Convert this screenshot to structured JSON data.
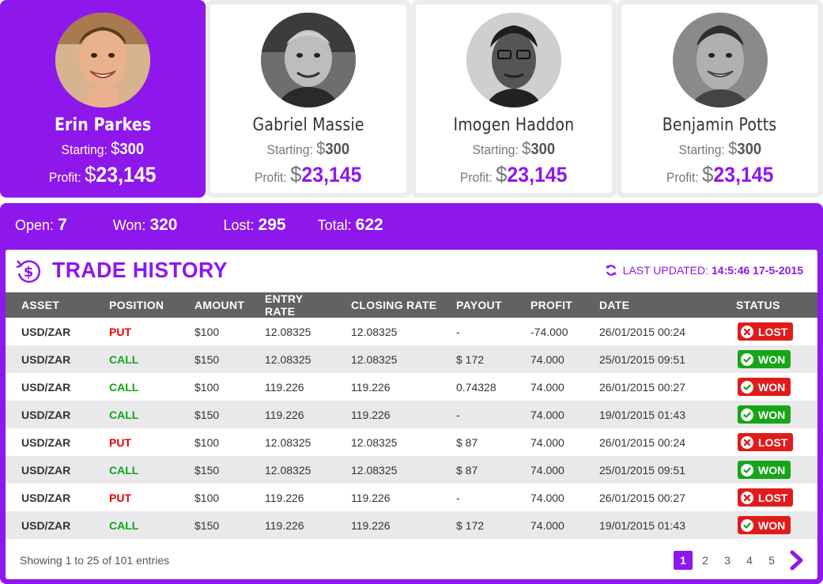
{
  "traders": [
    {
      "name": "Erin Parkes",
      "starting_label": "Starting:",
      "currency": "$",
      "starting_value": "300",
      "profit_label": "Profit:",
      "profit_value": "23,145",
      "active": true
    },
    {
      "name": "Gabriel Massie",
      "starting_label": "Starting:",
      "currency": "$",
      "starting_value": "300",
      "profit_label": "Profit:",
      "profit_value": "23,145",
      "active": false
    },
    {
      "name": "Imogen Haddon",
      "starting_label": "Starting:",
      "currency": "$",
      "starting_value": "300",
      "profit_label": "Profit:",
      "profit_value": "23,145",
      "active": false
    },
    {
      "name": "Benjamin Potts",
      "starting_label": "Starting:",
      "currency": "$",
      "starting_value": "300",
      "profit_label": "Profit:",
      "profit_value": "23,145",
      "active": false
    }
  ],
  "stats": {
    "open_label": "Open:",
    "open_value": "7",
    "won_label": "Won:",
    "won_value": "320",
    "lost_label": "Lost:",
    "lost_value": "295",
    "total_label": "Total:",
    "total_value": "622"
  },
  "history": {
    "title": "TRADE HISTORY",
    "updated_label": "LAST UPDATED:",
    "updated_value": "14:5:46 17-5-2015",
    "columns": [
      "ASSET",
      "POSITION",
      "AMOUNT",
      "ENTRY RATE",
      "CLOSING RATE",
      "PAYOUT",
      "PROFIT",
      "DATE",
      "STATUS"
    ],
    "rows": [
      {
        "asset": "USD/ZAR",
        "position": "PUT",
        "amount": "$100",
        "entry": "12.08325",
        "closing": "12.08325",
        "payout": "-",
        "profit": "-74.000",
        "date": "26/01/2015 00:24",
        "status": "LOST"
      },
      {
        "asset": "USD/ZAR",
        "position": "CALL",
        "amount": "$150",
        "entry": "12.08325",
        "closing": "12.08325",
        "payout": "$ 172",
        "profit": "74.000",
        "date": "25/01/2015 09:51",
        "status": "WON"
      },
      {
        "asset": "USD/ZAR",
        "position": "CALL",
        "amount": "$100",
        "entry": "119.226",
        "closing": "119.226",
        "payout": "0.74328",
        "profit": "74.000",
        "date": "26/01/2015 00:27",
        "status": "WON"
      },
      {
        "asset": "USD/ZAR",
        "position": "CALL",
        "amount": "$150",
        "entry": "119.226",
        "closing": "119.226",
        "payout": "-",
        "profit": "74.000",
        "date": "19/01/2015 01:43",
        "status": "WON"
      },
      {
        "asset": "USD/ZAR",
        "position": "PUT",
        "amount": "$100",
        "entry": "12.08325",
        "closing": "12.08325",
        "payout": "$ 87",
        "profit": "74.000",
        "date": "26/01/2015 00:24",
        "status": "LOST"
      },
      {
        "asset": "USD/ZAR",
        "position": "CALL",
        "amount": "$150",
        "entry": "12.08325",
        "closing": "12.08325",
        "payout": "$ 87",
        "profit": "74.000",
        "date": "25/01/2015 09:51",
        "status": "WON"
      },
      {
        "asset": "USD/ZAR",
        "position": "PUT",
        "amount": "$100",
        "entry": "119.226",
        "closing": "119.226",
        "payout": "-",
        "profit": "74.000",
        "date": "26/01/2015 00:27",
        "status": "LOST"
      },
      {
        "asset": "USD/ZAR",
        "position": "CALL",
        "amount": "$150",
        "entry": "119.226",
        "closing": "119.226",
        "payout": "$ 172",
        "profit": "74.000",
        "date": "19/01/2015 01:43",
        "status": "WON"
      }
    ],
    "status_colors": [
      "green",
      "green",
      "red",
      "green",
      "green",
      "green",
      "green",
      "red"
    ],
    "showing": "Showing 1 to 25 of 101 entries",
    "pages": [
      "1",
      "2",
      "3",
      "4",
      "5"
    ],
    "current_page": "1"
  },
  "colors": {
    "accent": "#8e17ec",
    "put": "#e60000",
    "call": "#14a514",
    "won": "#16a516",
    "lost": "#e11b1b",
    "header": "#626262"
  },
  "icons": {
    "history": "dollar-history-icon",
    "refresh": "refresh-icon",
    "next": "chevron-right-icon",
    "won": "check-circle-icon",
    "lost": "x-circle-icon"
  }
}
